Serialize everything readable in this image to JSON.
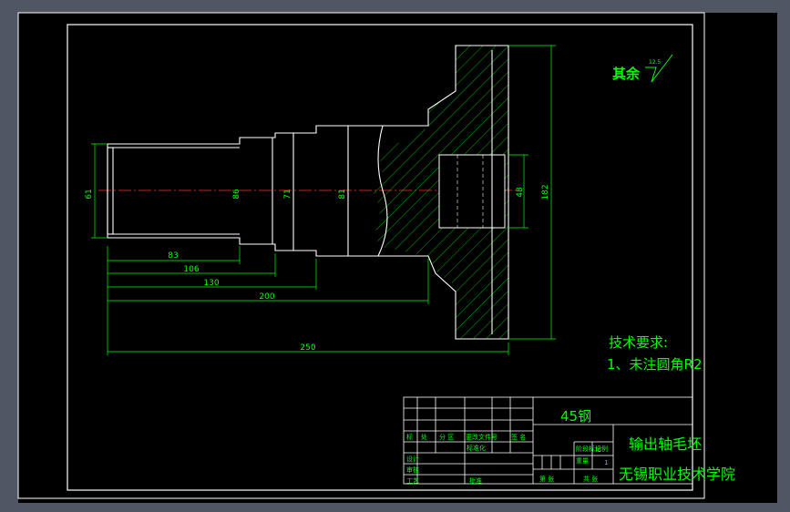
{
  "drawing": {
    "roughness_note": "其余",
    "roughness_value": "12.5",
    "tech_requirements_title": "技术要求:",
    "tech_requirements_item": "1、未注圆角R2"
  },
  "dimensions": {
    "d61": "61",
    "d86": "86",
    "d71": "71",
    "d81": "81",
    "d48": "48",
    "d182": "182",
    "l83": "83",
    "l106": "106",
    "l130": "130",
    "l200": "200",
    "l250": "250"
  },
  "title_block": {
    "material": "45钢",
    "part_name": "输出轴毛坯",
    "school": "无锡职业技术学院",
    "rev_headers": [
      "标",
      "处",
      "分 区",
      "更改文件号",
      "签 名"
    ],
    "row_design": "设计",
    "row_std": "标准化",
    "row_check": "审核",
    "row_process": "工艺",
    "row_approve": "批准",
    "stage_label": "阶段标记",
    "weight_label": "重量",
    "scale_label": "比例",
    "scale_value": "1",
    "sheets_label": "共 张",
    "sheet_label": "第 张"
  }
}
